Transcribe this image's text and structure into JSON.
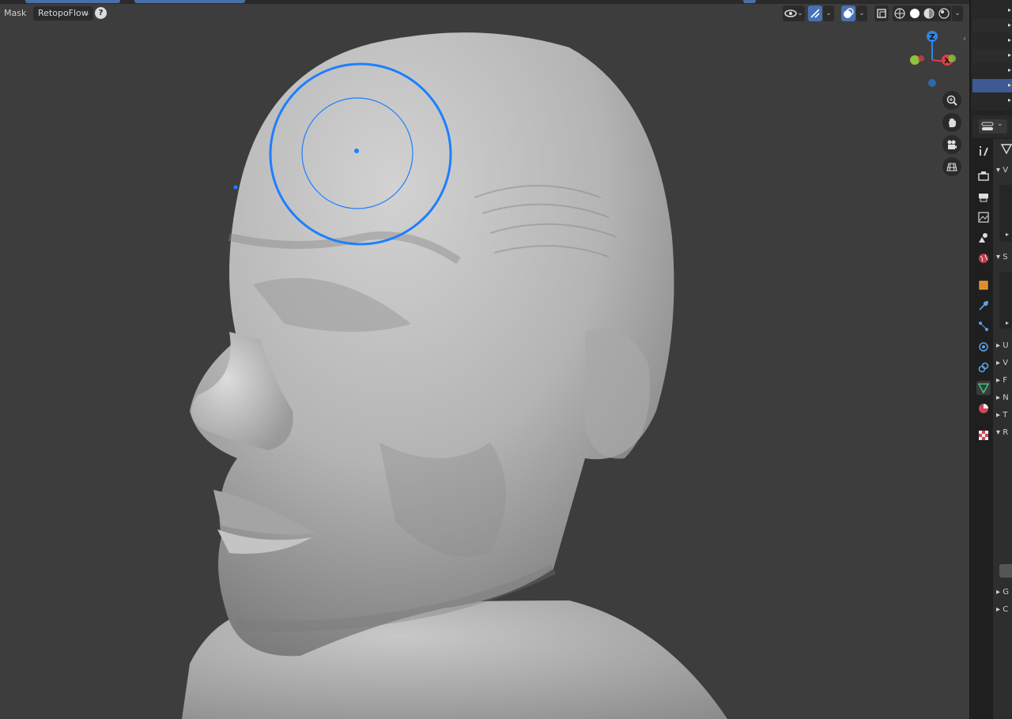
{
  "header": {
    "mode_label": "Mask",
    "addon_dropdown": "RetopoFlow",
    "help_label": "?"
  },
  "gizmo": {
    "z_label": "Z",
    "x_label": "X",
    "colors": {
      "x": "#e03c48",
      "y": "#8cc43c",
      "z": "#2d86e8"
    }
  },
  "navigation": [
    "zoom-icon",
    "pan-hand-icon",
    "camera-icon",
    "grid-ortho-icon"
  ],
  "shading_modes": [
    "wireframe",
    "solid",
    "material-preview",
    "rendered"
  ],
  "properties_tabs": [
    "tool",
    "render",
    "output",
    "view-layer",
    "scene",
    "world",
    "object",
    "modifiers",
    "particles",
    "physics",
    "constraints",
    "data",
    "material",
    "texture"
  ],
  "properties_panels": {
    "letters": [
      "V",
      "S",
      "U",
      "V",
      "F",
      "N",
      "T",
      "R",
      "G",
      "C"
    ]
  },
  "colors": {
    "accent": "#4772b3",
    "brush_circle": "#1e7fff",
    "viewport_bg": "#3d3d3d"
  }
}
